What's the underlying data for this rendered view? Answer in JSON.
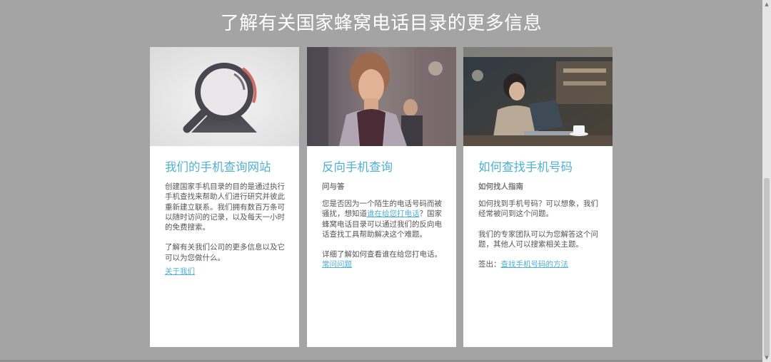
{
  "page": {
    "title": "了解有关国家蜂窝电话目录的更多信息"
  },
  "cards": [
    {
      "title": "我们的手机查询网站",
      "paragraph1": "创建国家手机目录的目的是通过执行手机查找来帮助人们进行研究并彼此重新建立联系。我们拥有数百万条可以随时访问的记录，以及每天一小时的免费搜索。",
      "paragraph2": "了解有关我们公司的更多信息以及它可以为您做什么。",
      "link": "关于我们"
    },
    {
      "title": "反向手机查询",
      "subtitle": "问与答",
      "p1_before": "您是否因为一个陌生的电话号码而被骚扰，想知道",
      "p1_link": "谁在给您打电话",
      "p1_after": "？国家蜂窝电话目录可以通过我们的反向电话查找工具帮助解决这个难题。",
      "p2_text": "详细了解如何查看谁在给您打电话。",
      "p2_link": "常问问题"
    },
    {
      "title": "如何查找手机号码",
      "subtitle": "如何找人指南",
      "paragraph1": "如何找到手机号码？可以想象，我们经常被问到这个问题。",
      "paragraph2": "我们的专家团队可以为您解答这个问题，其他人可以搜索相关主题。",
      "p3_label": "签出：",
      "p3_link": "查找手机号码的方法"
    }
  ],
  "colors": {
    "background": "#a4a4a4",
    "accent": "#4fb0d2",
    "card": "#ffffff"
  },
  "icons": [
    "magnifying-glass-icon",
    "scroll-up-arrow-icon",
    "scroll-down-arrow-icon"
  ]
}
